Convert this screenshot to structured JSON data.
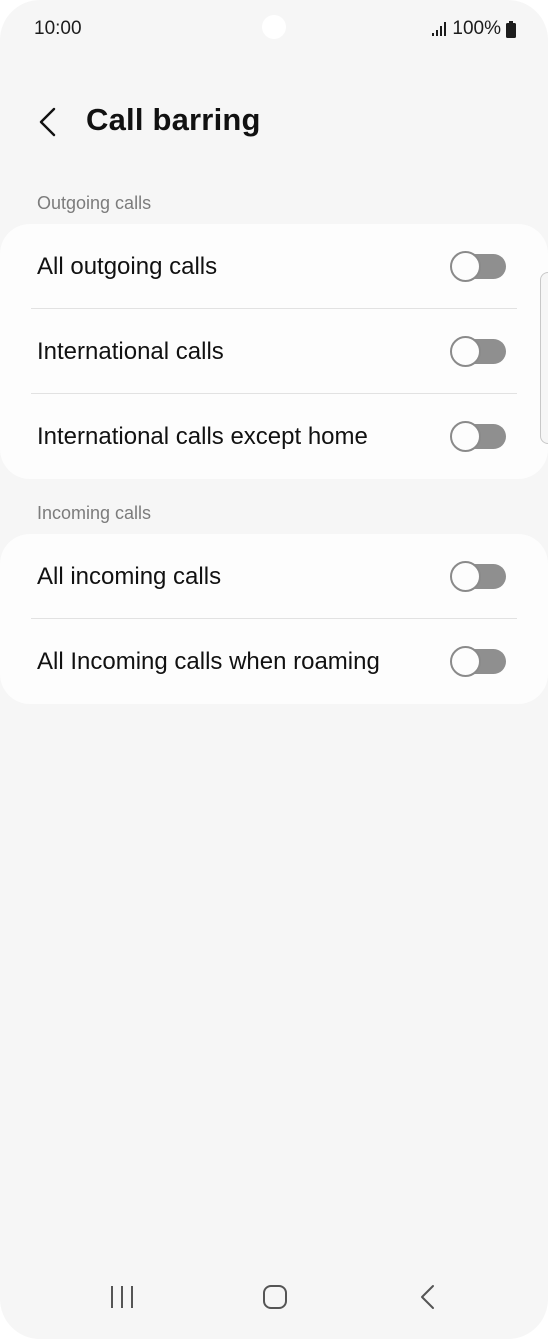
{
  "status_bar": {
    "time": "10:00",
    "battery": "100%",
    "icons": [
      "signal-icon",
      "battery-icon"
    ]
  },
  "header": {
    "back_icon": "chevron-left-icon",
    "title": "Call barring"
  },
  "sections": [
    {
      "label": "Outgoing calls",
      "items": [
        {
          "label": "All outgoing calls",
          "enabled": false
        },
        {
          "label": "International calls",
          "enabled": false
        },
        {
          "label": "International calls except home",
          "enabled": false
        }
      ]
    },
    {
      "label": "Incoming calls",
      "items": [
        {
          "label": "All incoming calls",
          "enabled": false
        },
        {
          "label": "All Incoming calls when roaming",
          "enabled": false
        }
      ]
    }
  ],
  "nav_bar": {
    "icons": [
      "recents-icon",
      "home-icon",
      "back-icon"
    ]
  },
  "colors": {
    "background": "#f6f6f6",
    "card": "#fdfdfd",
    "toggle_off_track": "#8f8f8f",
    "section_label": "#7c7c7c"
  }
}
